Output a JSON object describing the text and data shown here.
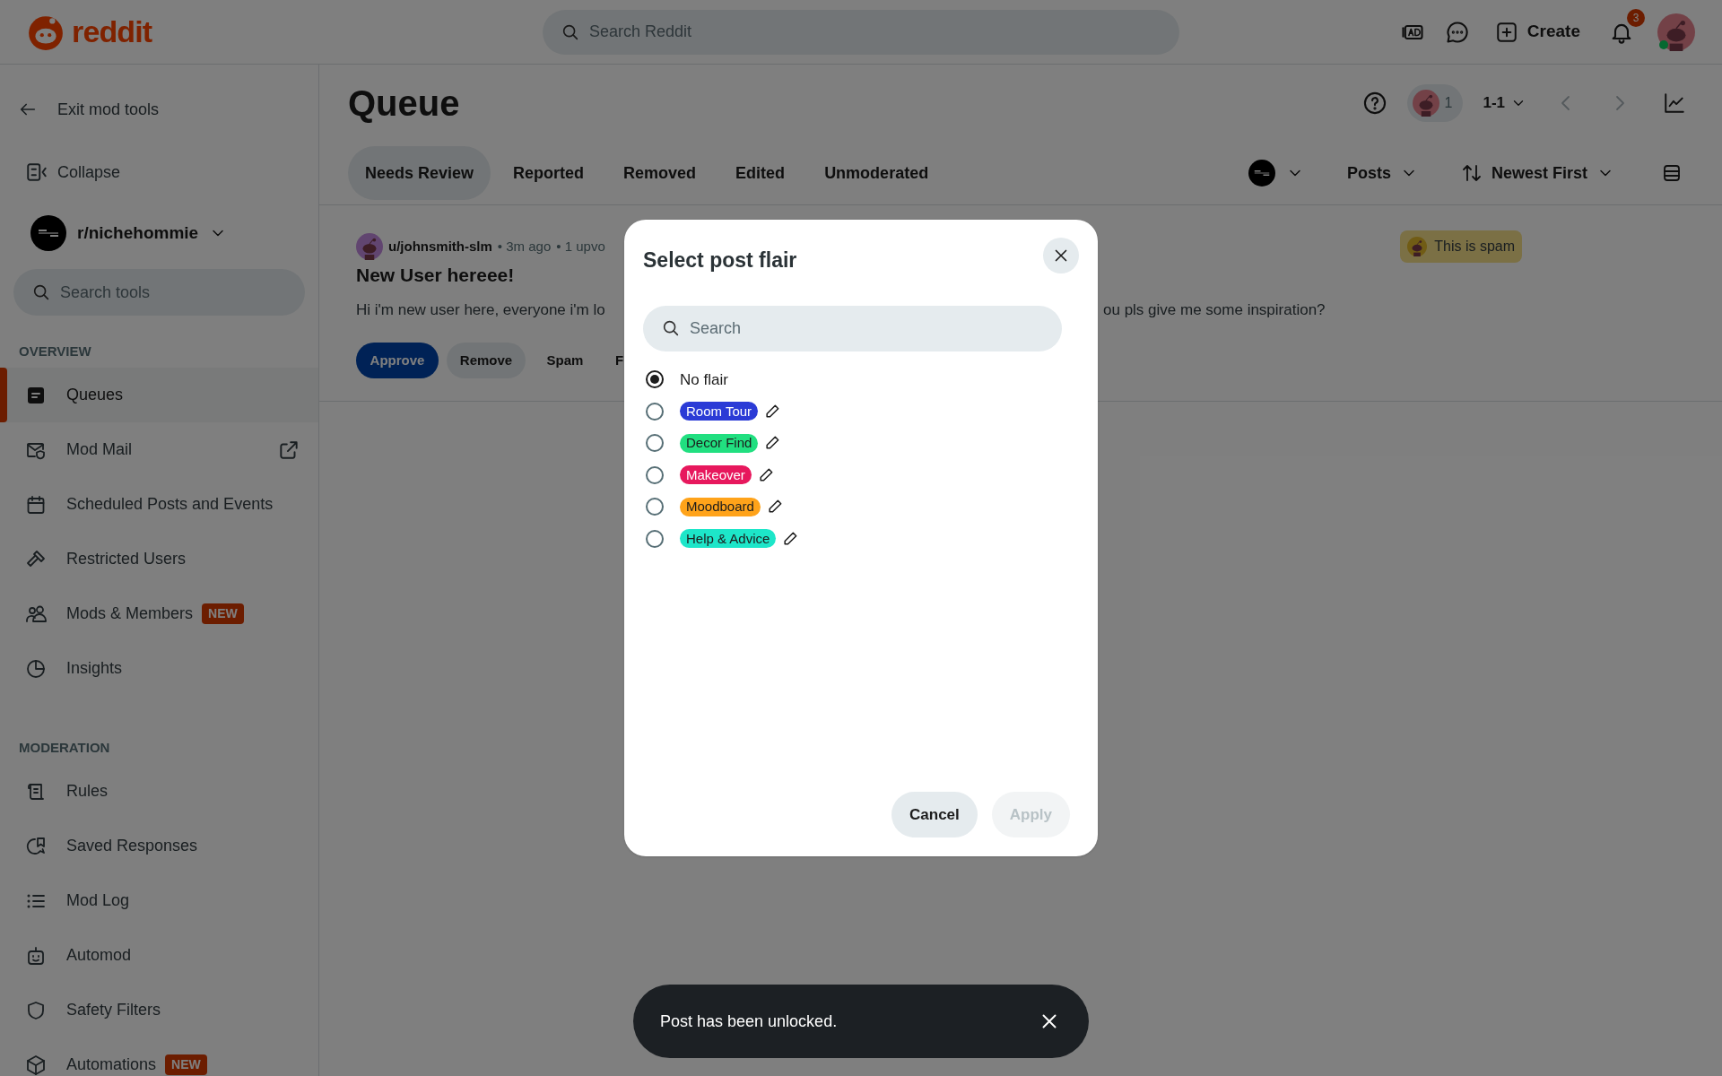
{
  "header": {
    "logo": "reddit",
    "search": {
      "placeholder": "Search Reddit"
    },
    "create": "Create",
    "notification_count": "3"
  },
  "sidebar": {
    "exit": "Exit mod tools",
    "collapse": "Collapse",
    "community": "r/nichehommie",
    "search": {
      "placeholder": "Search tools"
    },
    "sections": [
      {
        "title": "OVERVIEW",
        "items": [
          {
            "label": "Queues",
            "selected": true
          },
          {
            "label": "Mod Mail",
            "selected": false,
            "external": true
          },
          {
            "label": "Scheduled Posts and Events",
            "selected": false
          },
          {
            "label": "Restricted Users",
            "selected": false
          },
          {
            "label": "Mods & Members",
            "selected": false,
            "badge": "NEW"
          },
          {
            "label": "Insights",
            "selected": false
          }
        ]
      },
      {
        "title": "MODERATION",
        "items": [
          {
            "label": "Rules",
            "selected": false
          },
          {
            "label": "Saved Responses",
            "selected": false
          },
          {
            "label": "Mod Log",
            "selected": false
          },
          {
            "label": "Automod",
            "selected": false
          },
          {
            "label": "Safety Filters",
            "selected": false
          },
          {
            "label": "Automations",
            "selected": false,
            "badge": "NEW"
          }
        ]
      }
    ]
  },
  "queue": {
    "title": "Queue",
    "moderator_count": "1",
    "range": "1-1",
    "tabs": [
      {
        "label": "Needs Review",
        "selected": true
      },
      {
        "label": "Reported",
        "selected": false
      },
      {
        "label": "Removed",
        "selected": false
      },
      {
        "label": "Edited",
        "selected": false
      },
      {
        "label": "Unmoderated",
        "selected": false
      }
    ],
    "type_filter": "Posts",
    "sort": "Newest First",
    "post": {
      "author": "u/johnsmith-slm",
      "time": "• 3m ago",
      "meta": "• 1 upvo",
      "label": "This is spam",
      "title": "New User hereee!",
      "body_left": "Hi i'm new user here, everyone i'm lo",
      "body_right": "ou pls give me some inspiration?",
      "actions": [
        "Approve",
        "Remove",
        "Spam",
        "F"
      ]
    }
  },
  "modal": {
    "title": "Select post flair",
    "search": {
      "placeholder": "Search"
    },
    "options": [
      {
        "label": "No flair",
        "selected": true
      },
      {
        "label": "Room Tour",
        "color": "#2b3bd6",
        "selected": false
      },
      {
        "label": "Decor Find",
        "color": "#21df80",
        "selected": false
      },
      {
        "label": "Makeover",
        "color": "#e7185d",
        "selected": false
      },
      {
        "label": "Moodboard",
        "color": "#ffa31a",
        "selected": false
      },
      {
        "label": "Help & Advice",
        "color": "#1de6c9",
        "selected": false
      }
    ],
    "cancel": "Cancel",
    "apply": {
      "label": "Apply",
      "disabled": true
    }
  },
  "toast": {
    "message": "Post has been unlocked."
  }
}
